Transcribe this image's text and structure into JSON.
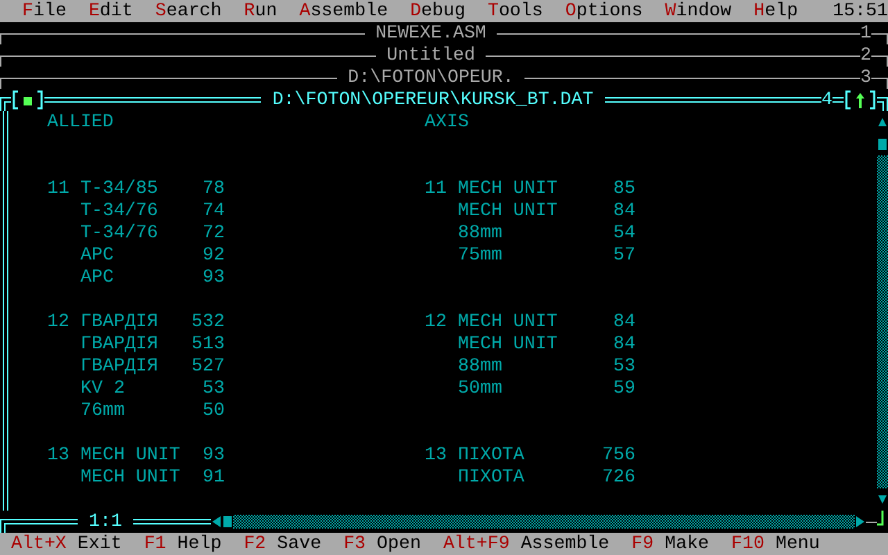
{
  "menu_bar": {
    "items": [
      {
        "label": "File"
      },
      {
        "label": "Edit"
      },
      {
        "label": "Search"
      },
      {
        "label": "Run"
      },
      {
        "label": "Assemble"
      },
      {
        "label": "Debug"
      },
      {
        "label": "Tools"
      },
      {
        "label": "Options"
      },
      {
        "label": "Window"
      },
      {
        "label": "Help"
      }
    ],
    "clock": "15:51"
  },
  "background_windows": [
    {
      "title": "NEWEXE.ASM",
      "number": "1"
    },
    {
      "title": "Untitled",
      "number": "2"
    },
    {
      "title": "D:\\FOTON\\OPEUR.",
      "number": "3"
    }
  ],
  "editor": {
    "title": "D:\\FOTON\\OPEREUR\\KURSK_BT.DAT",
    "number": "4",
    "position": "1:1",
    "columns": [
      {
        "heading": "ALLIED"
      },
      {
        "heading": "AXIS"
      }
    ],
    "groups": [
      {
        "sides": [
          {
            "number": "11",
            "units": [
              {
                "name": "T-34/85",
                "value": "78"
              },
              {
                "name": "T-34/76",
                "value": "74"
              },
              {
                "name": "T-34/76",
                "value": "72"
              },
              {
                "name": "APC",
                "value": "92"
              },
              {
                "name": "APC",
                "value": "93"
              }
            ]
          },
          {
            "number": "11",
            "units": [
              {
                "name": "MECH UNIT",
                "value": "85"
              },
              {
                "name": "MECH UNIT",
                "value": "84"
              },
              {
                "name": "88mm",
                "value": "54"
              },
              {
                "name": "75mm",
                "value": "57"
              }
            ]
          }
        ]
      },
      {
        "sides": [
          {
            "number": "12",
            "units": [
              {
                "name": "ГВАРДІЯ",
                "value": "532"
              },
              {
                "name": "ГВАРДІЯ",
                "value": "513"
              },
              {
                "name": "ГВАРДІЯ",
                "value": "527"
              },
              {
                "name": "KV 2",
                "value": "53"
              },
              {
                "name": "76mm",
                "value": "50"
              }
            ]
          },
          {
            "number": "12",
            "units": [
              {
                "name": "MECH UNIT",
                "value": "84"
              },
              {
                "name": "MECH UNIT",
                "value": "84"
              },
              {
                "name": "88mm",
                "value": "53"
              },
              {
                "name": "50mm",
                "value": "59"
              }
            ]
          }
        ]
      },
      {
        "sides": [
          {
            "number": "13",
            "units": [
              {
                "name": "MECH UNIT",
                "value": "93"
              },
              {
                "name": "MECH UNIT",
                "value": "91"
              }
            ]
          },
          {
            "number": "13",
            "units": [
              {
                "name": "ПІХОТА",
                "value": "756"
              },
              {
                "name": "ПІХОТА",
                "value": "726"
              }
            ]
          }
        ]
      }
    ]
  },
  "status_bar": [
    {
      "key": "Alt+X",
      "label": "Exit"
    },
    {
      "key": "F1",
      "label": "Help"
    },
    {
      "key": "F2",
      "label": "Save"
    },
    {
      "key": "F3",
      "label": "Open"
    },
    {
      "key": "Alt+F9",
      "label": "Assemble"
    },
    {
      "key": "F9",
      "label": "Make"
    },
    {
      "key": "F10",
      "label": "Menu"
    }
  ]
}
